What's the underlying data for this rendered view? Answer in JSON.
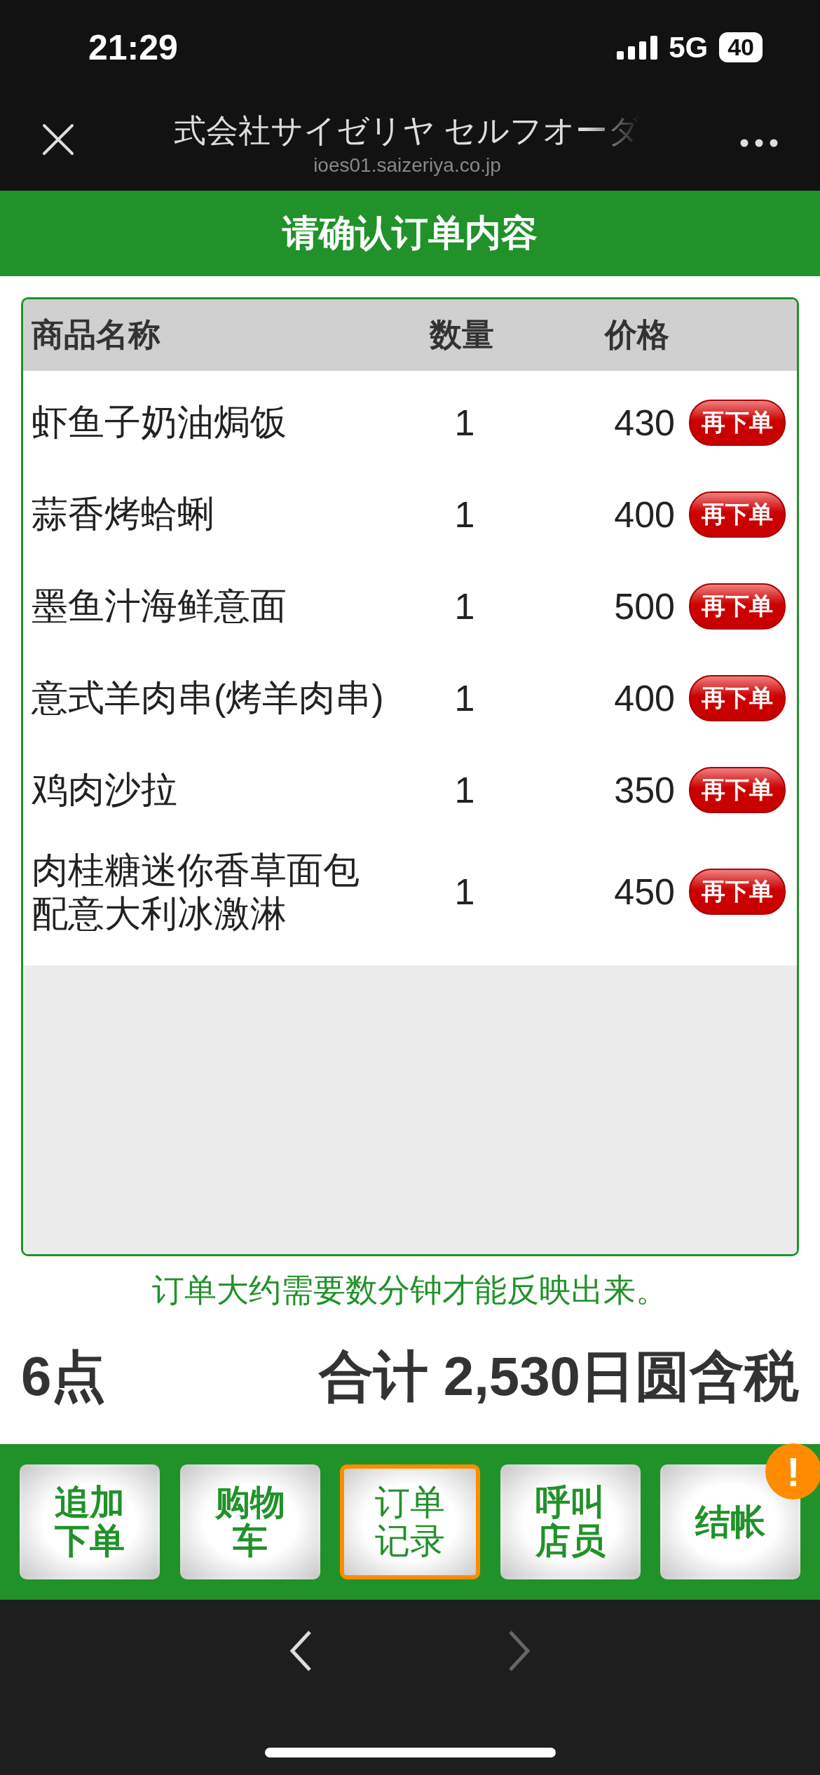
{
  "status_bar": {
    "time": "21:29",
    "network": "5G",
    "battery": "40"
  },
  "browser_bar": {
    "title": "式会社サイゼリヤ セルフオーダ",
    "url": "ioes01.saizeriya.co.jp"
  },
  "header": {
    "title": "请确认订单内容"
  },
  "table": {
    "columns": [
      "商品名称",
      "数量",
      "价格"
    ],
    "rows": [
      {
        "name": "虾鱼子奶油焗饭",
        "qty": "1",
        "price": "430",
        "action": "再下单"
      },
      {
        "name": "蒜香烤蛤蜊",
        "qty": "1",
        "price": "400",
        "action": "再下单"
      },
      {
        "name": "墨鱼汁海鲜意面",
        "qty": "1",
        "price": "500",
        "action": "再下单"
      },
      {
        "name": "意式羊肉串(烤羊肉串)",
        "qty": "1",
        "price": "400",
        "action": "再下单"
      },
      {
        "name": "鸡肉沙拉",
        "qty": "1",
        "price": "350",
        "action": "再下单"
      },
      {
        "name": "肉桂糖迷你香草面包配意大利冰激淋",
        "qty": "1",
        "price": "450",
        "action": "再下单"
      }
    ]
  },
  "note": "订单大约需要数分钟才能反映出来。",
  "summary": {
    "count": "6点",
    "total": "合计 2,530日圆含税"
  },
  "nav_buttons": [
    {
      "label": "追加下单",
      "selected": false
    },
    {
      "label": "购物车",
      "selected": false
    },
    {
      "label": "订单记录",
      "selected": true
    },
    {
      "label": "呼叫店员",
      "selected": false
    },
    {
      "label": "结帐",
      "selected": false,
      "badge": "!"
    }
  ]
}
